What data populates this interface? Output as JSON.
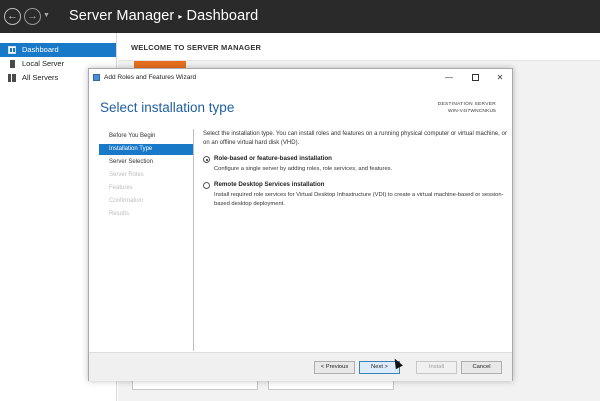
{
  "app": {
    "title": "Server Manager",
    "separator": "▸",
    "page": "Dashboard"
  },
  "sidebar": {
    "items": [
      {
        "label": "Dashboard",
        "icon": "dashboard-icon",
        "active": true
      },
      {
        "label": "Local Server",
        "icon": "server-icon",
        "active": false
      },
      {
        "label": "All Servers",
        "icon": "servers-icon",
        "active": false
      }
    ]
  },
  "main": {
    "welcome_title": "WELCOME TO SERVER MANAGER"
  },
  "wizard": {
    "window_title": "Add Roles and Features Wizard",
    "heading": "Select installation type",
    "destination_label": "DESTINATION SERVER",
    "destination_server": "WIN-V4I7WNCNKU5",
    "steps": [
      {
        "label": "Before You Begin",
        "state": "done"
      },
      {
        "label": "Installation Type",
        "state": "current"
      },
      {
        "label": "Server Selection",
        "state": "pending"
      },
      {
        "label": "Server Roles",
        "state": "disabled"
      },
      {
        "label": "Features",
        "state": "disabled"
      },
      {
        "label": "Confirmation",
        "state": "disabled"
      },
      {
        "label": "Results",
        "state": "disabled"
      }
    ],
    "description": "Select the installation type. You can install roles and features on a running physical computer or virtual machine, or on an offline virtual hard disk (VHD).",
    "options": [
      {
        "label": "Role-based or feature-based installation",
        "description": "Configure a single server by adding roles, role services, and features.",
        "selected": true
      },
      {
        "label": "Remote Desktop Services installation",
        "description": "Install required role services for Virtual Desktop Infrastructure (VDI) to create a virtual machine-based or session-based desktop deployment.",
        "selected": false
      }
    ],
    "buttons": {
      "previous": "< Previous",
      "next": "Next >",
      "install": "Install",
      "cancel": "Cancel"
    }
  },
  "colors": {
    "accent": "#1979c9",
    "heading": "#1f5fa0",
    "titlebar": "#2a2a2a",
    "tile": "#e96f1f"
  }
}
